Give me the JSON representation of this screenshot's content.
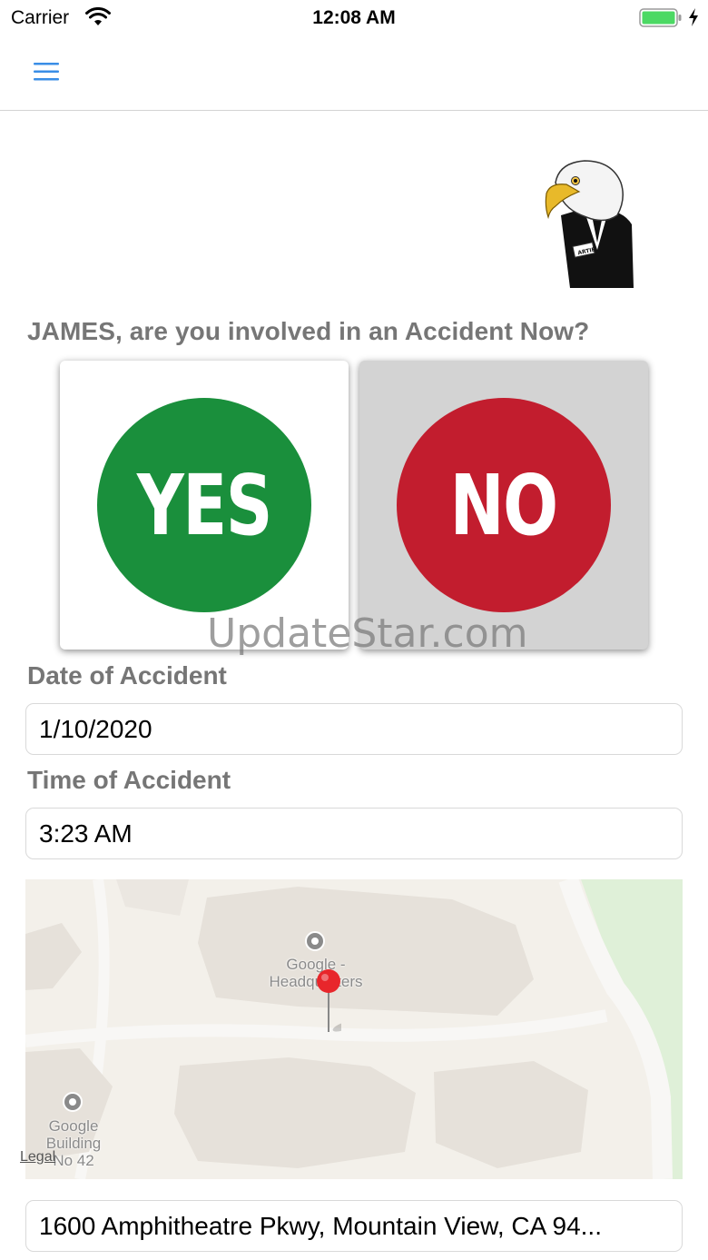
{
  "status_bar": {
    "carrier": "Carrier",
    "time": "12:08 AM",
    "battery_color": "#4cd964"
  },
  "nav": {
    "menu_icon": "hamburger-menu-icon",
    "accent_color": "#3a8ee6"
  },
  "mascot": {
    "icon": "eagle-mascot-icon",
    "badge_text": "ARTIE"
  },
  "question": "JAMES, are you involved in an Accident Now?",
  "choices": {
    "yes": {
      "label": "YES",
      "color": "#1a8f3c"
    },
    "no": {
      "label": "NO",
      "color": "#c21d2e"
    }
  },
  "watermark": "UpdateStar.com",
  "form": {
    "date_label": "Date of Accident",
    "date_value": "1/10/2020",
    "time_label": "Time of Accident",
    "time_value": "3:23 AM",
    "address_value": "1600 Amphitheatre Pkwy, Mountain View, CA 94..."
  },
  "map": {
    "poi_1": "Google -\nHeadquarters",
    "poi_2": "Google\nBuilding\nNo 42",
    "legal": "Legal",
    "pin_icon": "map-pin-icon"
  }
}
